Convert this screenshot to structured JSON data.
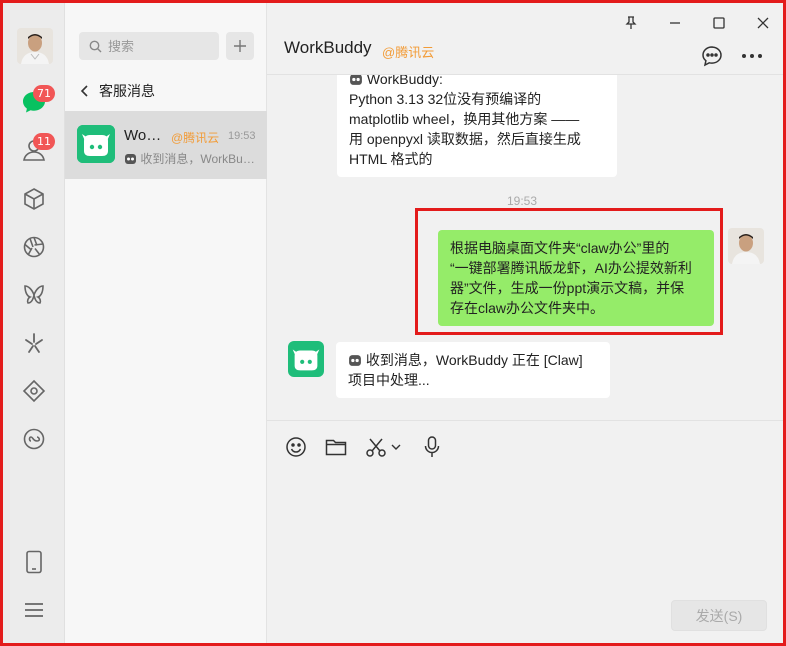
{
  "rail": {
    "chat_badge": "71",
    "contacts_badge": "11",
    "icons": [
      "chat-icon",
      "contacts-icon",
      "cube-icon",
      "aperture-icon",
      "butterfly-icon",
      "sparkle-icon",
      "diamond-icon",
      "miniprogram-icon",
      "phone-icon",
      "menu-icon"
    ]
  },
  "list": {
    "search_placeholder": "搜索",
    "back_label": "客服消息",
    "conversation": {
      "name": "WorkBuddy",
      "org": "@腾讯云",
      "time": "19:53",
      "preview": "收到消息，WorkBuddy 正在 [Claw] 项目中处理..."
    }
  },
  "chat": {
    "title": "WorkBuddy",
    "title_org": "@腾讯云",
    "msg1": {
      "line0": "WorkBuddy:",
      "line1": "Python 3.13 32位没有预编译的",
      "line2": "matplotlib wheel，换用其他方案 ——",
      "line3": "用 openpyxl 读取数据，然后直接生成",
      "line4": "HTML 格式的"
    },
    "timestamp": "19:53",
    "msg2": {
      "line1": "根据电脑桌面文件夹“claw办公”里的",
      "line2": "“一键部署腾讯版龙虾，AI办公提效新利",
      "line3": "器”文件，生成一份ppt演示文稿，并保",
      "line4": "存在claw办公文件夹中。"
    },
    "msg3": {
      "line1": "收到消息，WorkBuddy 正在 [Claw]",
      "line2": "项目中处理..."
    },
    "send_label": "发送(S)"
  },
  "colors": {
    "accent_green": "#95ec69",
    "brand_orange": "#f29c38",
    "badge_red": "#f15656",
    "highlight_red": "#e31b1b",
    "bot_green": "#1fbd7a"
  }
}
